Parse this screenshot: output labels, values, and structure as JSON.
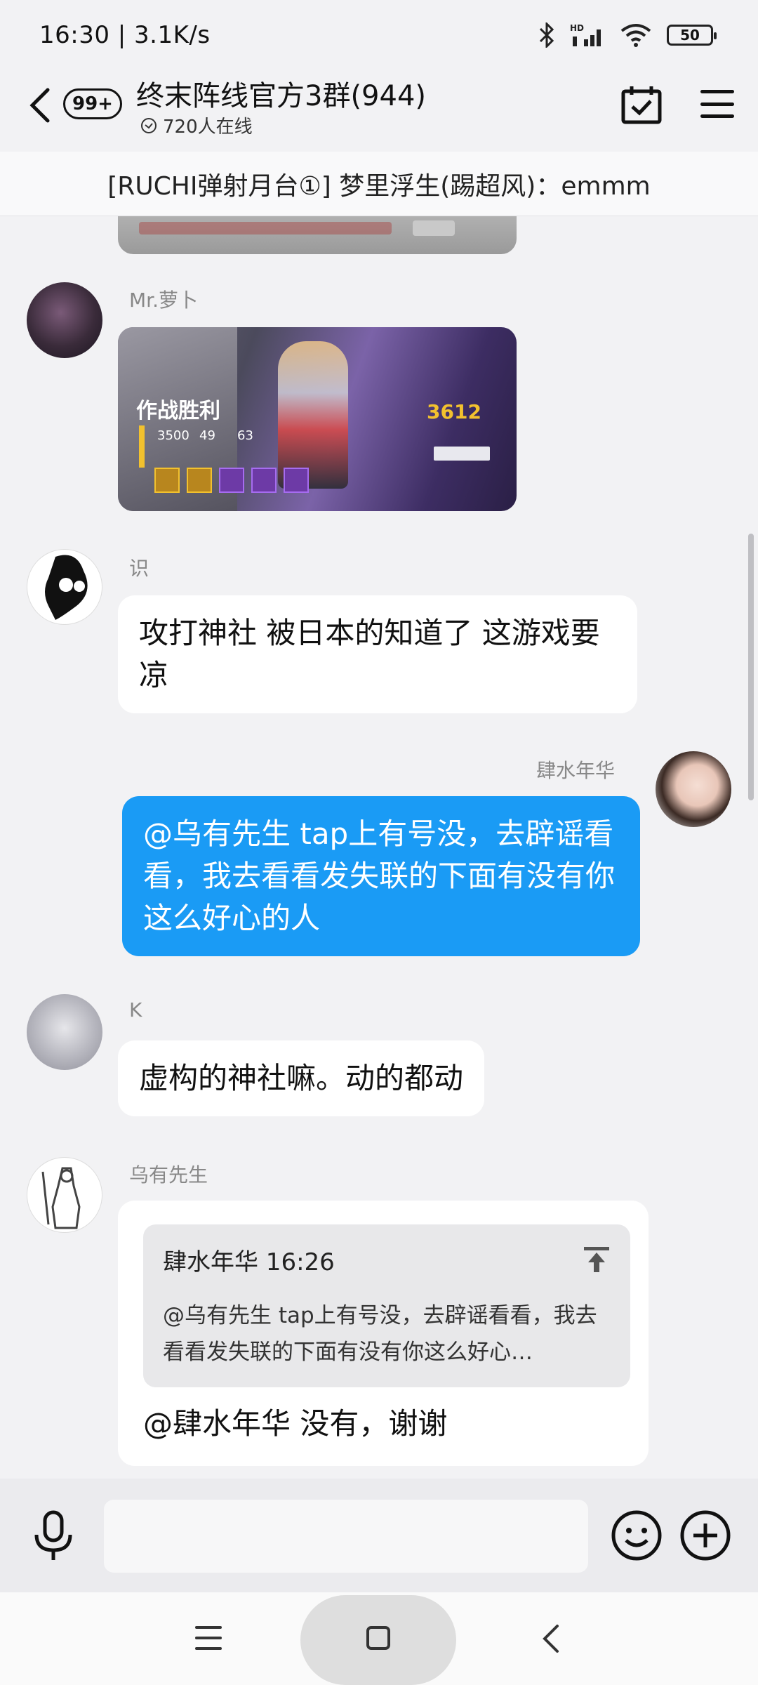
{
  "status_bar": {
    "time_speed": "16:30 | 3.1K/s",
    "battery": "50",
    "network_label": "HD"
  },
  "header": {
    "unread_badge": "99+",
    "group_title": "终末阵线官方3群(944)",
    "online_count": "720人在线"
  },
  "pinned_message": "[RUCHI弹射月台①] 梦里浮生(踢超风)：emmm",
  "messages": [
    {
      "sender": "Mr.萝卜",
      "type": "image",
      "image": {
        "victory_text": "作战胜利",
        "stat1": "3500",
        "stat2": "49",
        "stat3": "63",
        "score": "3612",
        "accent": "#f2c12e"
      }
    },
    {
      "sender": "识",
      "type": "text",
      "text": "攻打神社 被日本的知道了 这游戏要凉"
    },
    {
      "sender": "肆水年华",
      "type": "text",
      "mine": true,
      "text": "@乌有先生 tap上有号没，去辟谣看看，我去看看发失联的下面有没有你这么好心的人"
    },
    {
      "sender": "K",
      "type": "text",
      "text": "虚构的神社嘛。动的都动"
    },
    {
      "sender": "乌有先生",
      "type": "reply",
      "quote_head": "肆水年华 16:26",
      "quote_body": "@乌有先生 tap上有号没，去辟谣看看，我去看看发失联的下面有没有你这么好心…",
      "text": "@肆水年华 没有，谢谢"
    }
  ],
  "input": {
    "placeholder": ""
  },
  "colors": {
    "my_bubble": "#1a9bf5",
    "background": "#f2f2f4"
  }
}
